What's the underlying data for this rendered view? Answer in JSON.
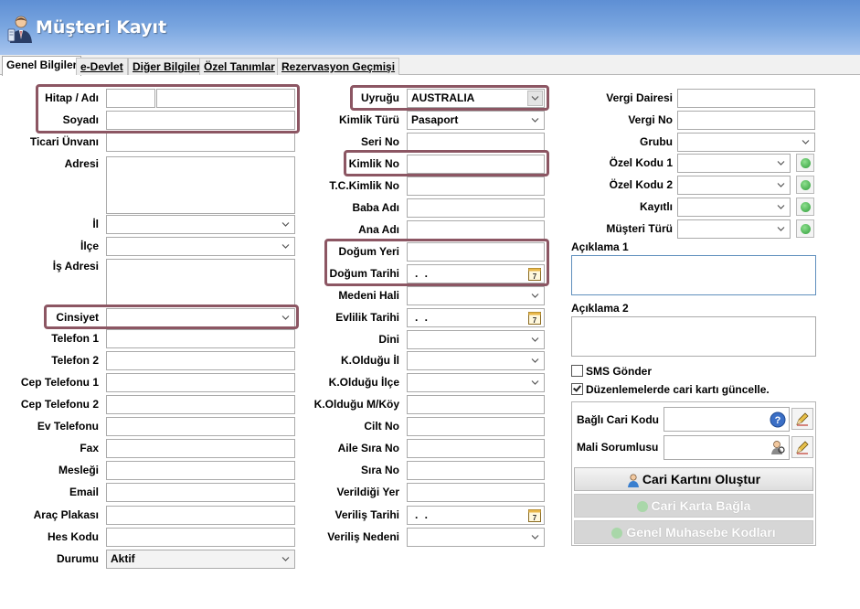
{
  "window": {
    "title": "Müşteri Kayıt"
  },
  "tabs": [
    {
      "label": "Genel Bilgiler",
      "active": true
    },
    {
      "label": "e-Devlet"
    },
    {
      "label": "Diğer Bilgiler"
    },
    {
      "label": "Özel Tanımlar"
    },
    {
      "label": "Rezervasyon Geçmişi"
    }
  ],
  "left": {
    "hitap_adi_label": "Hitap / Adı",
    "soyadi_label": "Soyadı",
    "ticari_unvani_label": "Ticari Ünvanı",
    "adresi_label": "Adresi",
    "il_label": "İl",
    "ilce_label": "İlçe",
    "is_adresi_label": "İş Adresi",
    "cinsiyet_label": "Cinsiyet",
    "telefon1_label": "Telefon 1",
    "telefon2_label": "Telefon 2",
    "cep1_label": "Cep Telefonu 1",
    "cep2_label": "Cep Telefonu 2",
    "ev_telefonu_label": "Ev Telefonu",
    "fax_label": "Fax",
    "meslegi_label": "Mesleği",
    "email_label": "Email",
    "arac_plakasi_label": "Araç Plakası",
    "hes_kodu_label": "Hes Kodu",
    "durumu_label": "Durumu",
    "durumu_value": "Aktif"
  },
  "middle": {
    "uyrugu_label": "Uyruğu",
    "uyrugu_value": "AUSTRALIA",
    "kimlik_turu_label": "Kimlik Türü",
    "kimlik_turu_value": "Pasaport",
    "seri_no_label": "Seri No",
    "kimlik_no_label": "Kimlik No",
    "tc_kimlik_no_label": "T.C.Kimlik No",
    "baba_adi_label": "Baba Adı",
    "ana_adi_label": "Ana Adı",
    "dogum_yeri_label": "Doğum Yeri",
    "dogum_tarihi_label": "Doğum Tarihi",
    "dogum_tarihi_value": ". .",
    "medeni_hali_label": "Medeni Hali",
    "evlilik_tarihi_label": "Evlilik Tarihi",
    "evlilik_tarihi_value": ". .",
    "dini_label": "Dini",
    "k_oldugu_il_label": "K.Olduğu İl",
    "k_oldugu_ilce_label": "K.Olduğu İlçe",
    "k_oldugu_mkoy_label": "K.Olduğu M/Köy",
    "cilt_no_label": "Cilt No",
    "aile_sira_no_label": "Aile Sıra No",
    "sira_no_label": "Sıra No",
    "verildigi_yer_label": "Verildiği Yer",
    "verilis_tarihi_label": "Veriliş Tarihi",
    "verilis_tarihi_value": ". .",
    "verilis_nedeni_label": "Veriliş Nedeni"
  },
  "right": {
    "vergi_dairesi_label": "Vergi Dairesi",
    "vergi_no_label": "Vergi No",
    "grubu_label": "Grubu",
    "ozel_kodu1_label": "Özel Kodu 1",
    "ozel_kodu2_label": "Özel Kodu 2",
    "kayitli_label": "Kayıtlı",
    "musteri_turu_label": "Müşteri Türü",
    "aciklama1_label": "Açıklama 1",
    "aciklama2_label": "Açıklama 2",
    "sms_gonder_label": "SMS Gönder",
    "sms_gonder_checked": false,
    "duzenleme_label": "Düzenlemelerde cari kartı güncelle.",
    "duzenleme_checked": true,
    "bagli_cari_kodu_label": "Bağlı Cari Kodu",
    "mali_sorumlusu_label": "Mali Sorumlusu",
    "cari_karti_olustur": "Cari Kartını Oluştur",
    "cari_karta_bagla": "Cari Karta Bağla",
    "genel_muhasebe_kodlari": "Genel Muhasebe Kodları"
  },
  "icons": [
    "user-icon",
    "chevron-down-icon",
    "calendar-icon",
    "add-green-icon",
    "help-icon",
    "edit-pencil-icon",
    "person-search-icon",
    "person-icon"
  ],
  "colors": {
    "header_top": "#5e8fd4",
    "header_bottom": "#a7c4ee",
    "highlight": "#8c5663",
    "add_green": "#2f9d3a"
  }
}
